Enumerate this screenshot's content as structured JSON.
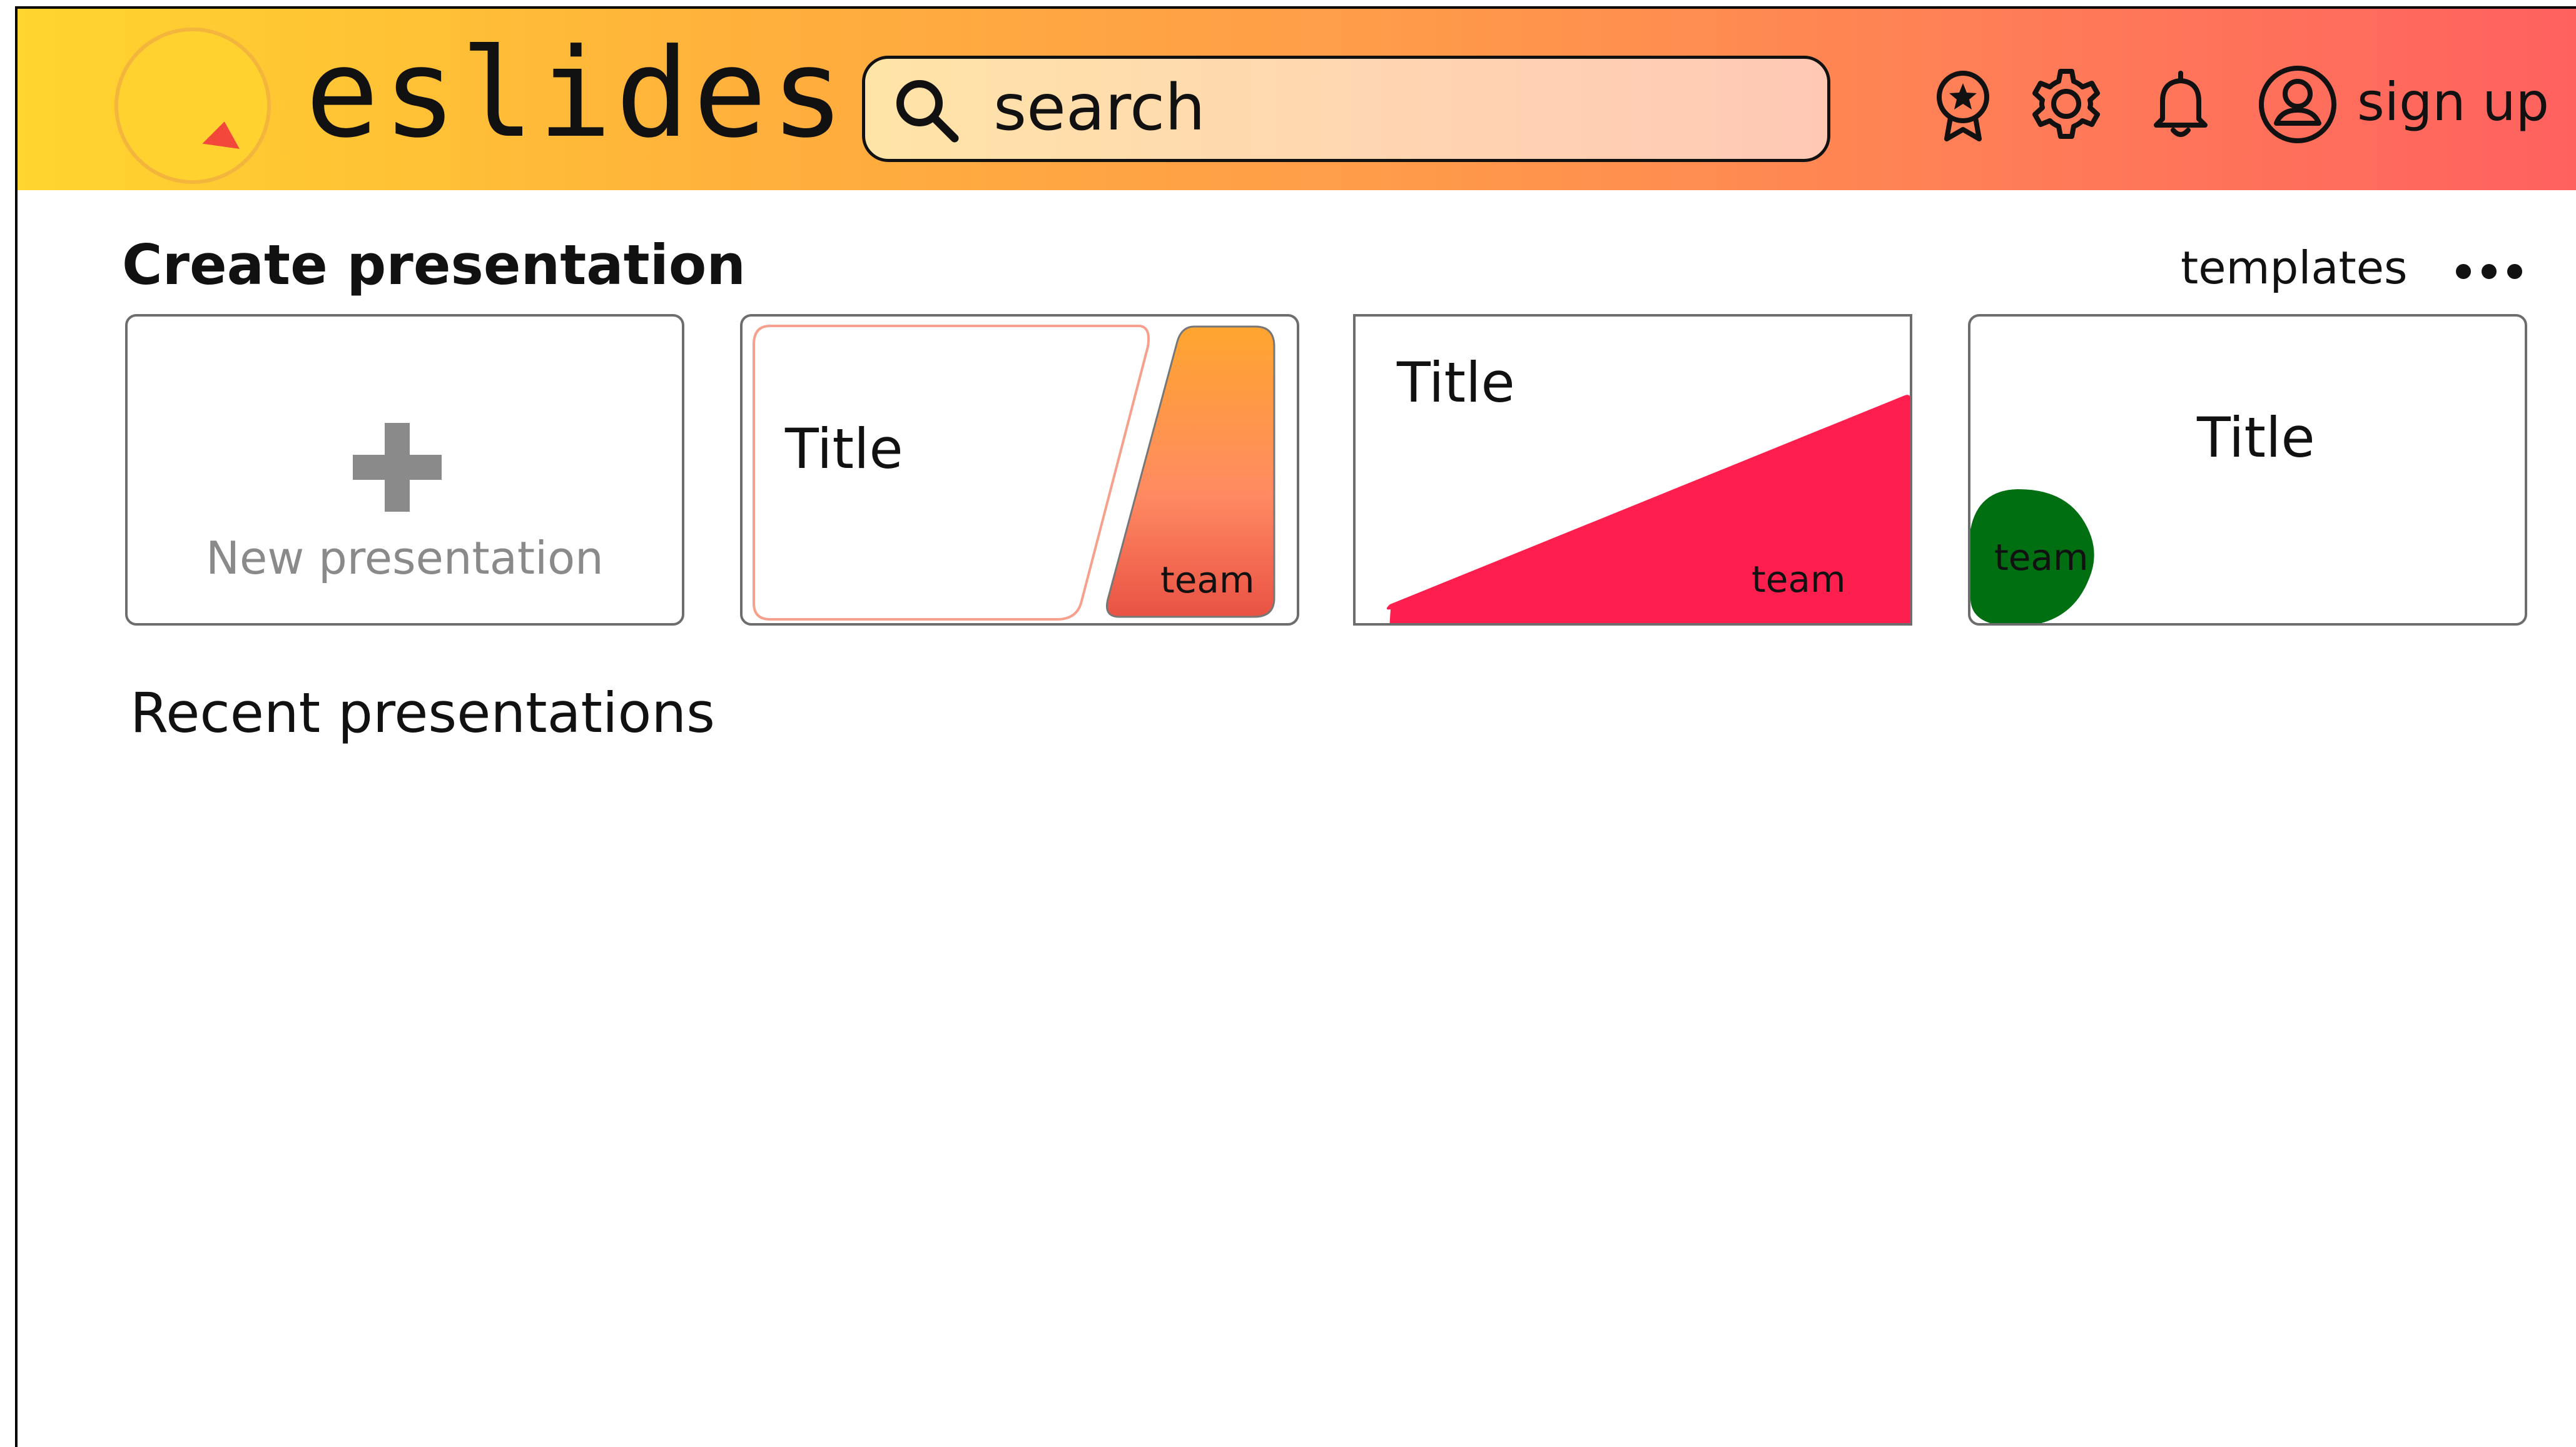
{
  "app": {
    "brand": "eslides"
  },
  "header": {
    "search_placeholder": "search",
    "icons": [
      "award-icon",
      "gear-icon",
      "bell-icon",
      "user-icon"
    ],
    "signup_label": "sign up"
  },
  "create": {
    "title": "Create presentation",
    "templates_link": "templates",
    "new_presentation_label": "New presentation",
    "templates": [
      {
        "title": "Title",
        "team_label": "team"
      },
      {
        "title": "Title",
        "team_label": "team"
      },
      {
        "title": "Title",
        "team_label": "team"
      }
    ]
  },
  "recent": {
    "title": "Recent presentations"
  },
  "colors": {
    "header_gradient_start": "#ffd52e",
    "header_gradient_end": "#ff615f",
    "logo_red": "#f4473c",
    "template_orange": "#ffa52f",
    "template_red": "#ff1f4f",
    "template_green": "#006f12",
    "new_presentation_gray": "#8a8a8a"
  }
}
